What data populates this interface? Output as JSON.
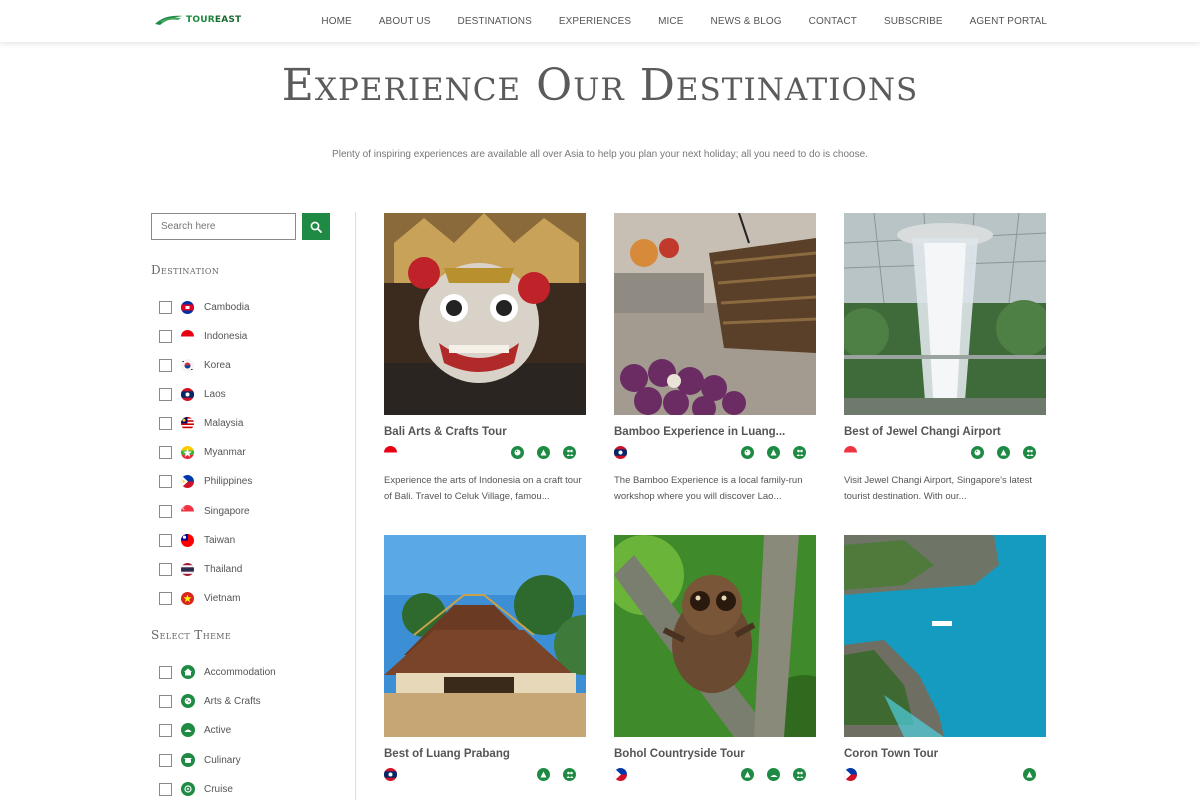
{
  "header": {
    "logo_text_1": "TOUR",
    "logo_text_2": "EAST",
    "nav": [
      "HOME",
      "ABOUT US",
      "DESTINATIONS",
      "EXPERIENCES",
      "MICE",
      "NEWS & BLOG",
      "CONTACT",
      "SUBSCRIBE",
      "AGENT PORTAL"
    ]
  },
  "hero": {
    "title": "Experience Our Destinations",
    "subtitle": "Plenty of inspiring experiences are available all over Asia to help you plan your next holiday; all you need to do is choose."
  },
  "sidebar": {
    "search_placeholder": "Search here",
    "destination_heading": "Destination",
    "destinations": [
      "Cambodia",
      "Indonesia",
      "Korea",
      "Laos",
      "Malaysia",
      "Myanmar",
      "Philippines",
      "Singapore",
      "Taiwan",
      "Thailand",
      "Vietnam"
    ],
    "theme_heading": "Select Theme",
    "themes": [
      "Accommodation",
      "Arts & Crafts",
      "Active",
      "Culinary",
      "Cruise"
    ]
  },
  "cards": [
    {
      "title": "Bali Arts & Crafts Tour",
      "country_flag": "indonesia",
      "themes": [
        "arts-crafts-icon",
        "active-icon",
        "community-icon"
      ],
      "desc": "Experience the arts of Indonesia on a craft tour of Bali. Travel to Celuk Village, famou..."
    },
    {
      "title": "Bamboo Experience in Luang...",
      "country_flag": "laos",
      "themes": [
        "arts-crafts-icon",
        "active-icon",
        "community-icon"
      ],
      "desc": "The Bamboo Experience is a local family-run workshop where you will discover Lao..."
    },
    {
      "title": "Best of Jewel Changi Airport",
      "country_flag": "singapore",
      "themes": [
        "arts-crafts-icon",
        "active-icon",
        "community-icon"
      ],
      "desc": "Visit Jewel Changi Airport, Singapore's latest tourist destination. With our..."
    },
    {
      "title": "Best of Luang Prabang",
      "country_flag": "laos",
      "themes": [
        "active-icon",
        "community-icon"
      ],
      "desc": ""
    },
    {
      "title": "Bohol Countryside Tour",
      "country_flag": "philippines",
      "themes": [
        "active-icon",
        "cruise-icon",
        "community-icon"
      ],
      "desc": ""
    },
    {
      "title": "Coron Town Tour",
      "country_flag": "philippines",
      "themes": [
        "active-icon"
      ],
      "desc": ""
    }
  ],
  "colors": {
    "brand_green": "#1e8a44",
    "text_gray": "#555555"
  }
}
